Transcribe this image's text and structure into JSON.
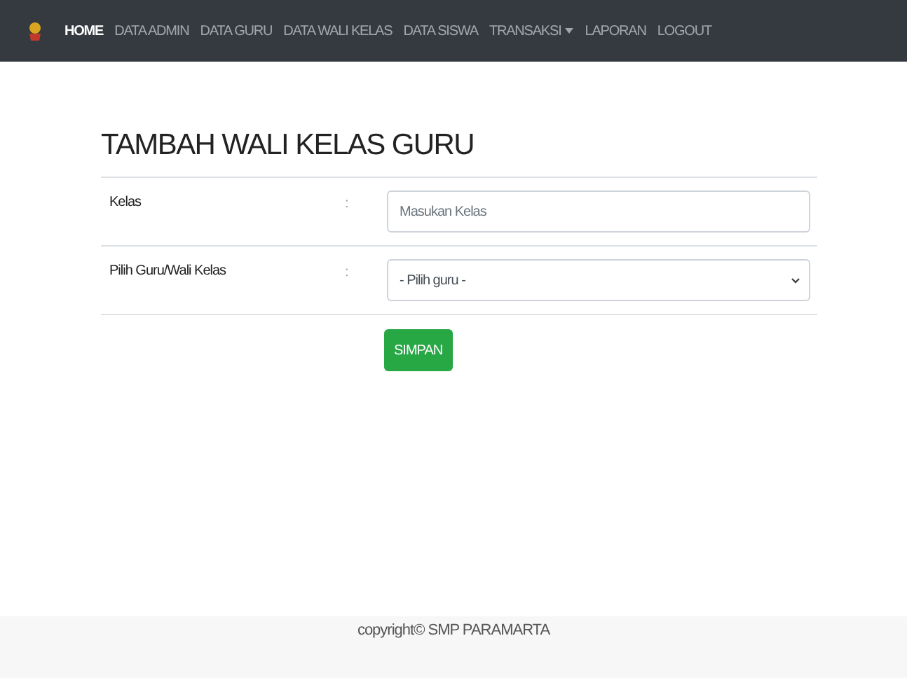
{
  "navbar": {
    "items": [
      {
        "label": "HOME",
        "selected": true,
        "dropdown": false
      },
      {
        "label": "DATA ADMIN",
        "selected": false,
        "dropdown": false
      },
      {
        "label": "DATA GURU",
        "selected": false,
        "dropdown": false
      },
      {
        "label": "DATA WALI KELAS",
        "selected": false,
        "dropdown": false
      },
      {
        "label": "DATA SISWA",
        "selected": false,
        "dropdown": false
      },
      {
        "label": "TRANSAKSI",
        "selected": false,
        "dropdown": true
      },
      {
        "label": "LAPORAN",
        "selected": false,
        "dropdown": false
      },
      {
        "label": "LOGOUT",
        "selected": false,
        "dropdown": false
      }
    ]
  },
  "form": {
    "title": "TAMBAH WALI KELAS GURU",
    "rows": [
      {
        "kind": "input",
        "label": "Kelas",
        "separator": ":",
        "placeholder": "Masukan Kelas"
      },
      {
        "kind": "select",
        "label": "Pilih Guru/Wali Kelas",
        "separator": ":",
        "value": "- Pilih guru -"
      }
    ],
    "submit": "SIMPAN"
  },
  "footer": {
    "text": "copyright© SMP PARAMARTA"
  }
}
